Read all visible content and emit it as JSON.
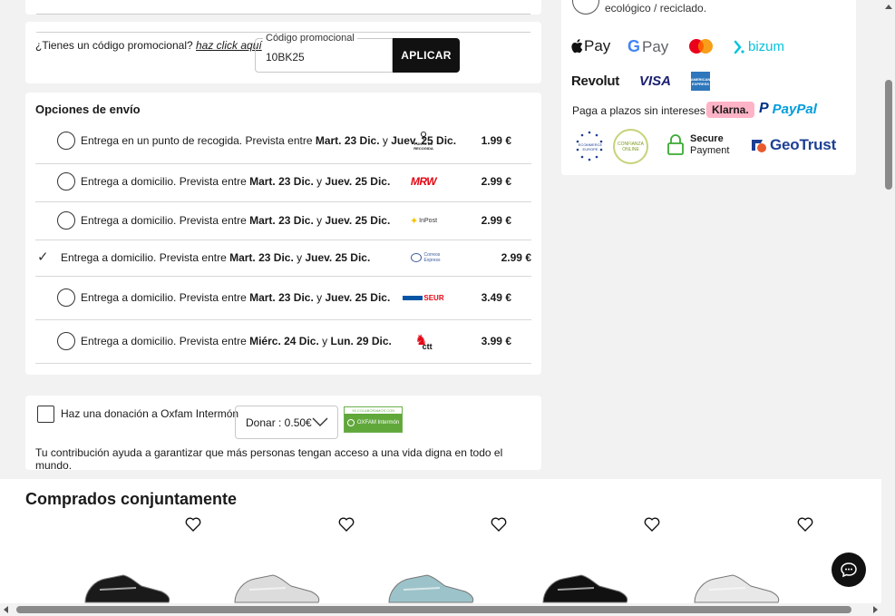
{
  "promo": {
    "question": "¿Tienes un código promocional?",
    "link": "haz click aquí",
    "field_label": "Código promocional",
    "field_value": "10BK25",
    "apply_label": "APLICAR"
  },
  "shipping": {
    "title": "Opciones de envío",
    "options": [
      {
        "prefix": "Entrega en un punto de recogida. Prevista entre ",
        "from": "Mart. 23 Dic.",
        "mid": " y ",
        "to": "Juev. 25 Dic.",
        "carrier": "PUNTO DE RECOGIDA",
        "price": "1.99 €",
        "selected": false
      },
      {
        "prefix": "Entrega a domicilio. Prevista entre ",
        "from": "Mart. 23 Dic.",
        "mid": " y ",
        "to": "Juev. 25 Dic.",
        "carrier": "MRW",
        "price": "2.99 €",
        "selected": false
      },
      {
        "prefix": "Entrega a domicilio. Prevista entre ",
        "from": "Mart. 23 Dic.",
        "mid": " y ",
        "to": "Juev. 25 Dic.",
        "carrier": "InPost",
        "price": "2.99 €",
        "selected": false
      },
      {
        "prefix": "Entrega a domicilio. Prevista entre ",
        "from": "Mart. 23 Dic.",
        "mid": " y ",
        "to": "Juev. 25 Dic.",
        "carrier": "Correos Express",
        "price": "2.99 €",
        "selected": true
      },
      {
        "prefix": "Entrega a domicilio. Prevista entre ",
        "from": "Mart. 23 Dic.",
        "mid": " y ",
        "to": "Juev. 25 Dic.",
        "carrier": "SEUR",
        "price": "3.49 €",
        "selected": false
      },
      {
        "prefix": "Entrega a domicilio. Prevista entre ",
        "from": "Miérc. 24 Dic.",
        "mid": " y ",
        "to": "Lun. 29 Dic.",
        "carrier": "ctt",
        "price": "3.99 €",
        "selected": false
      }
    ]
  },
  "donation": {
    "label": "Haz una donación a Oxfam Intermón",
    "select_value": "Donar : 0.50€",
    "badge_top": "YA COLABORAMOS CON",
    "badge_name": "OXFAM Intermón",
    "note": "Tu contribución ayuda a garantizar que más personas tengan acceso a una vida digna en todo el mundo."
  },
  "payments": {
    "eco_text": "ecológico / reciclado.",
    "apple_pay": "Pay",
    "google_pay": "Pay",
    "bizum": "bizum",
    "revolut": "Revolut",
    "visa": "VISA",
    "amex": "AMERICAN EXPRESS",
    "installments_label": "Paga a plazos sin intereses:",
    "klarna": "Klarna.",
    "paypal": "PayPal",
    "ecommerce_europe": "ECOMMERCE EUROPE",
    "confianza": "CONFIANZA ONLINE",
    "secure_payment_1": "Secure",
    "secure_payment_2": "Payment",
    "geotrust": "GeoTrust"
  },
  "related": {
    "title": "Comprados conjuntamente",
    "products": [
      {
        "shoe_color": "#1a1a1a"
      },
      {
        "shoe_color": "#dcdcdc"
      },
      {
        "shoe_color": "#9cc3c9"
      },
      {
        "shoe_color": "#111111"
      },
      {
        "shoe_color": "#e8e8e8"
      }
    ]
  },
  "colors": {
    "primary": "#111111",
    "paypal_dark": "#003087",
    "paypal_light": "#009cde",
    "klarna_pink": "#ffb3c7",
    "bizum": "#05c3dd",
    "mrw_red": "#e30613",
    "seur_blue": "#0055a5"
  }
}
